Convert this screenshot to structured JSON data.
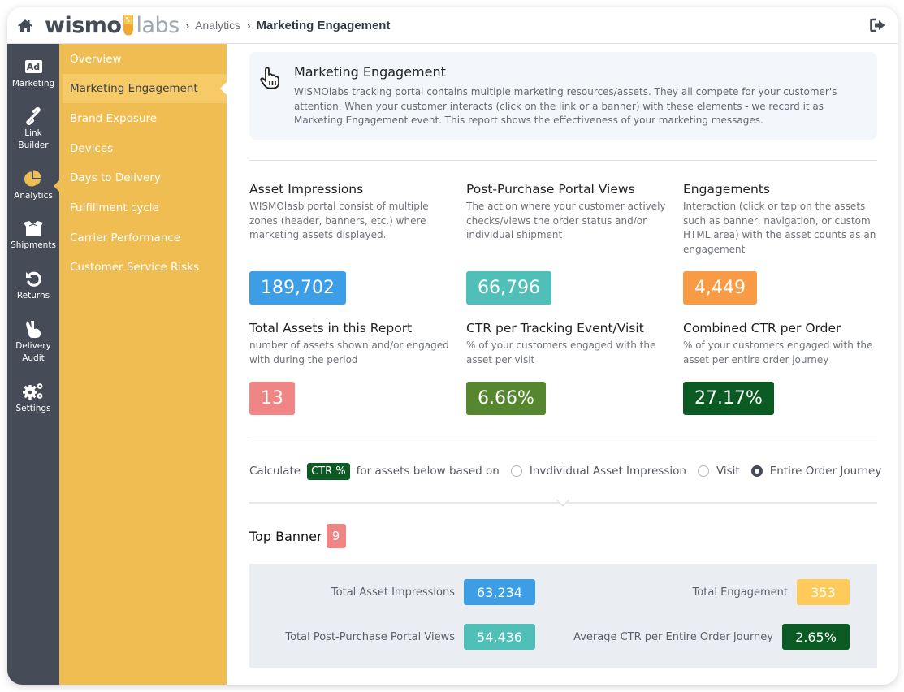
{
  "header": {
    "logo_left": "wismo",
    "logo_right": "labs",
    "breadcrumb": [
      "Analytics",
      "Marketing Engagement"
    ]
  },
  "sidebar": {
    "items": [
      {
        "label": "Marketing",
        "icon": "ad-icon"
      },
      {
        "label": "Link Builder",
        "label_lines": [
          "Link",
          "Builder"
        ],
        "icon": "link-icon"
      },
      {
        "label": "Analytics",
        "icon": "pie-chart-icon",
        "active": true
      },
      {
        "label": "Shipments",
        "icon": "box-icon"
      },
      {
        "label": "Returns",
        "icon": "undo-icon"
      },
      {
        "label": "Delivery Audit",
        "label_lines": [
          "Delivery",
          "Audit"
        ],
        "icon": "hand-peace-icon"
      },
      {
        "label": "Settings",
        "icon": "gears-icon"
      }
    ],
    "ad_text": "Ad"
  },
  "submenu": {
    "items": [
      {
        "label": "Overview"
      },
      {
        "label": "Marketing Engagement",
        "active": true
      },
      {
        "label": "Brand Exposure"
      },
      {
        "label": "Devices"
      },
      {
        "label": "Days to Delivery"
      },
      {
        "label": "Fulfillment cycle"
      },
      {
        "label": "Carrier Performance"
      },
      {
        "label": "Customer Service Risks"
      }
    ]
  },
  "intro": {
    "title": "Marketing Engagement",
    "text": "WISMOlabs tracking portal contains multiple marketing resources/assets. They all compete for your customer's attention. When your customer interacts (click on the link or a banner) with these elements - we record it as Marketing Engagement event. This report shows the effectiveness of your marketing messages."
  },
  "metrics": [
    {
      "title": "Asset Impressions",
      "desc": "WISMOlasb portal consist of multiple zones (header, banners, etc.) where marketing assets displayed.",
      "value": "189,702",
      "color": "#3d9ee8"
    },
    {
      "title": "Post-Purchase Portal Views",
      "desc": "The action where your customer actively checks/views the order status and/or individual shipment",
      "value": "66,796",
      "color": "#4fbfb8"
    },
    {
      "title": "Engagements",
      "desc": "Interaction (click or tap on the assets such as banner, navigation, or custom HTML area) with the asset counts as an engagement",
      "value": "4,449",
      "color": "#f99a45"
    },
    {
      "title": "Total Assets in this Report",
      "desc": "number of assets shown and/or engaged with during the period",
      "value": "13",
      "color": "#ef8585"
    },
    {
      "title": "CTR per Tracking Event/Visit",
      "desc": "% of your customers engaged with the asset per visit",
      "value": "6.66%",
      "color": "#568630"
    },
    {
      "title": "Combined CTR per Order",
      "desc": "% of your customers engaged with the asset per entire order journey",
      "value": "27.17%",
      "color": "#0b5a24"
    }
  ],
  "calc": {
    "prefix": "Calculate",
    "chip": "CTR %",
    "middle": "for assets below based on",
    "options": [
      {
        "label": "Invdividual Asset Impression",
        "checked": false
      },
      {
        "label": "Visit",
        "checked": false
      },
      {
        "label": "Entire Order Journey",
        "checked": true
      }
    ]
  },
  "section": {
    "title": "Top Banner",
    "count": "9",
    "stats": [
      {
        "label": "Total Asset Impressions",
        "value": "63,234",
        "color": "#3d9ee8"
      },
      {
        "label": "Total Post-Purchase Portal Views",
        "value": "54,436",
        "color": "#4fbfb8"
      },
      {
        "label": "Total Engagement",
        "value": "353",
        "color": "#fecb5a"
      },
      {
        "label": "Average CTR per Entire Order Journey",
        "value": "2.65%",
        "color": "#0b5a24"
      }
    ]
  },
  "colors": {
    "sidebar": "#454b57",
    "submenu": "#f0bd52",
    "submenu_active": "#f7ca68"
  }
}
